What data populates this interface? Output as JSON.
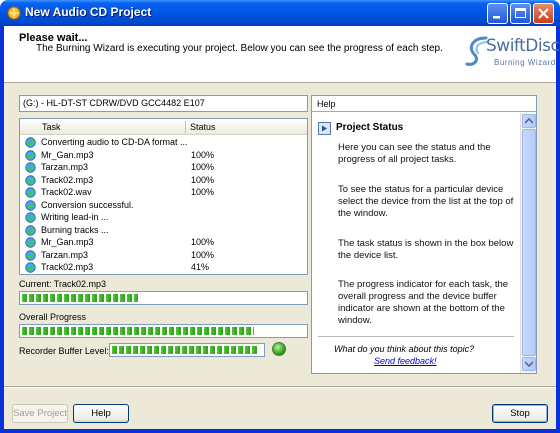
{
  "window": {
    "title": "New Audio CD Project"
  },
  "header": {
    "title": "Please wait...",
    "subtitle": "The Burning Wizard is executing your project. Below you can see the progress of each step.",
    "logo_main": "SwiftDisc",
    "logo_sub": "Burning Wizard"
  },
  "device": {
    "selected": "(G:) - HL-DT-ST CDRW/DVD GCC4482 E107"
  },
  "tasklist": {
    "columns": [
      "Task",
      "Status"
    ],
    "rows": [
      {
        "task": "Converting audio to CD-DA format ...",
        "status": ""
      },
      {
        "task": "Mr_Gan.mp3",
        "status": "100%"
      },
      {
        "task": "Tarzan.mp3",
        "status": "100%"
      },
      {
        "task": "Track02.mp3",
        "status": "100%"
      },
      {
        "task": "Track02.wav",
        "status": "100%"
      },
      {
        "task": "Conversion successful.",
        "status": ""
      },
      {
        "task": "Writing lead-in ...",
        "status": ""
      },
      {
        "task": "Burning tracks ...",
        "status": ""
      },
      {
        "task": "Mr_Gan.mp3",
        "status": "100%"
      },
      {
        "task": "Tarzan.mp3",
        "status": "100%"
      },
      {
        "task": "Track02.mp3",
        "status": "41%"
      }
    ]
  },
  "progress": {
    "current_label": "Current: Track02.mp3",
    "current_value": 0.41,
    "overall_label": "Overall Progress",
    "overall_value": 0.82,
    "buffer_label": "Recorder Buffer Level:",
    "buffer_value": 0.97
  },
  "help": {
    "tab": "Help",
    "heading": "Project Status",
    "paragraphs": [
      "Here you can see the status and the progress of all project tasks.",
      "To see the status for a particular device select the device from the list at the top of the window.",
      "The task status is shown in the box below the device list.",
      "The progress indicator for each task, the overall progress and the device buffer indicator are shown at the bottom of the window."
    ],
    "question": "What do you think about this topic?",
    "link": "Send feedback!"
  },
  "buttons": {
    "save_project": "Save Project",
    "help": "Help",
    "stop": "Stop"
  },
  "colors": {
    "progress": "#33a51f",
    "title_bar": "#0054e3",
    "panel": "#ece9d8"
  }
}
